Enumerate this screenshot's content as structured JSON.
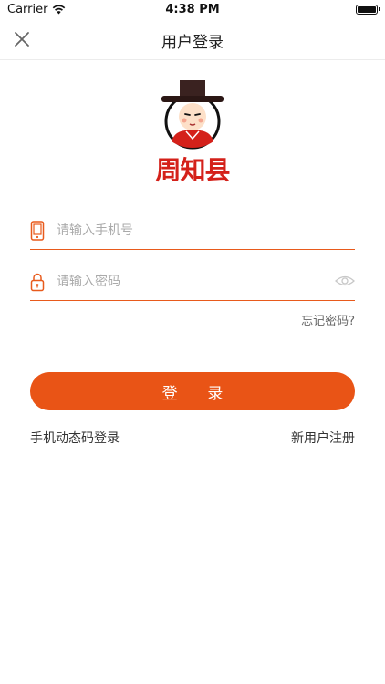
{
  "status_bar": {
    "carrier": "Carrier",
    "time": "4:38 PM"
  },
  "nav": {
    "title": "用户登录",
    "close_icon": "close-icon"
  },
  "brand": {
    "name": "周知县",
    "color": "#d4211a"
  },
  "phone": {
    "placeholder": "请输入手机号",
    "value": "",
    "icon": "phone-icon"
  },
  "password": {
    "placeholder": "请输入密码",
    "value": "",
    "icon": "lock-icon",
    "toggle_icon": "eye-icon"
  },
  "links": {
    "forgot": "忘记密码?",
    "sms_login": "手机动态码登录",
    "register": "新用户注册"
  },
  "login_button": {
    "label": "登 录",
    "color": "#e95416"
  }
}
